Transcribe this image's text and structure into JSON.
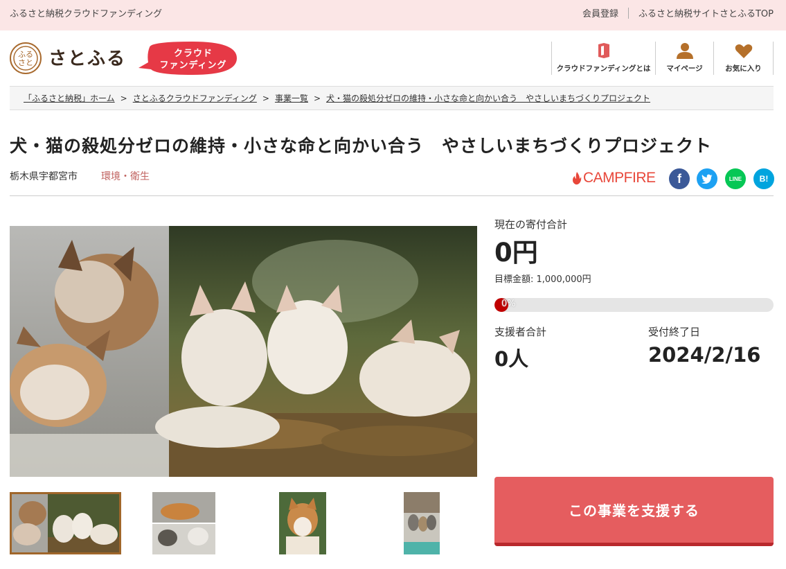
{
  "topbar": {
    "site_name": "ふるさと納税クラウドファンディング",
    "register": "会員登録",
    "satofull_top": "ふるさと納税サイトさとふるTOP"
  },
  "header": {
    "logo_text": "さとふる",
    "logo_mark_text": "ふるさと",
    "badge_line1": "クラウド",
    "badge_line2": "ファンディング",
    "nav": [
      {
        "label": "クラウドファンディングとは",
        "icon": "book-icon"
      },
      {
        "label": "マイページ",
        "icon": "user-icon"
      },
      {
        "label": "お気に入り",
        "icon": "heart-icon"
      }
    ]
  },
  "breadcrumb": [
    "「ふるさと納税」ホーム",
    "さとふるクラウドファンディング",
    "事業一覧",
    "犬・猫の殺処分ゼロの維持・小さな命と向かい合う　やさしいまちづくりプロジェクト"
  ],
  "breadcrumb_sep": ">",
  "project": {
    "title": "犬・猫の殺処分ゼロの維持・小さな命と向かい合う　やさしいまちづくりプロジェクト",
    "location": "栃木県宇都宮市",
    "category": "環境・衛生"
  },
  "partner_logo": "CAMPFIRE",
  "social": {
    "facebook": "f",
    "line": "LINE",
    "hatena": "B!"
  },
  "stats": {
    "current_label": "現在の寄付合計",
    "current_amount": "0円",
    "goal_label": "目標金額: 1,000,000円",
    "progress_text": "0%",
    "progress_fraction": 0,
    "supporters_label": "支援者合計",
    "supporters_value": "0人",
    "deadline_label": "受付終了日",
    "deadline_value": "2024/2/16"
  },
  "support_button": "この事業を支援する",
  "colors": {
    "accent": "#e55d5f",
    "category": "#c0625f",
    "topbar": "#fbe6e6",
    "brand_brown": "#a86a2e"
  }
}
